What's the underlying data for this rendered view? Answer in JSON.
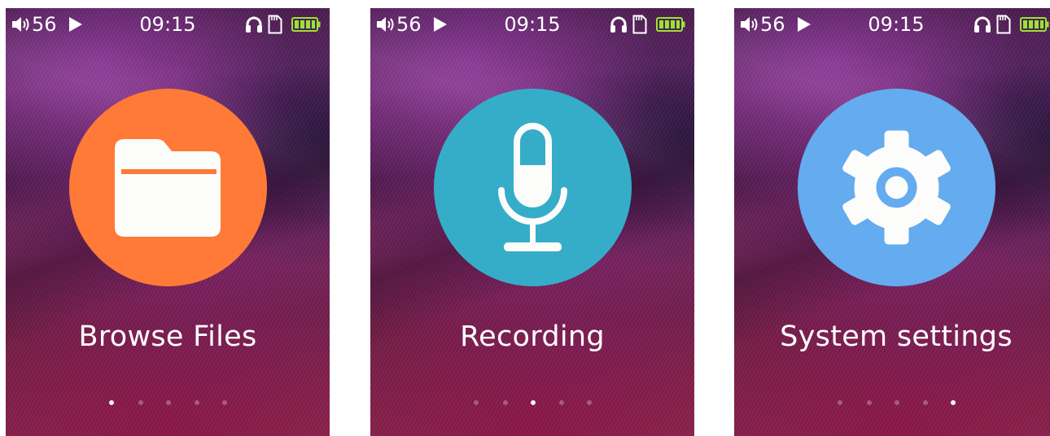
{
  "screens": [
    {
      "status": {
        "volume": "56",
        "time": "09:15"
      },
      "app": {
        "label": "Browse Files",
        "icon": "folder-icon",
        "color": "#fe7a36"
      },
      "page_indicator": {
        "count": 5,
        "active": 1
      }
    },
    {
      "status": {
        "volume": "56",
        "time": "09:15"
      },
      "app": {
        "label": "Recording",
        "icon": "microphone-icon",
        "color": "#35adc8"
      },
      "page_indicator": {
        "count": 5,
        "active": 3
      }
    },
    {
      "status": {
        "volume": "56",
        "time": "09:15"
      },
      "app": {
        "label": "System settings",
        "icon": "gear-icon",
        "color": "#64abef"
      },
      "page_indicator": {
        "count": 5,
        "active": 5
      }
    }
  ],
  "status_icons": {
    "volume": "speaker-icon",
    "playback": "play-icon",
    "audio_output": "headphones-icon",
    "storage": "sd-card-icon",
    "power": "battery-icon",
    "battery_color": "#9be234"
  }
}
